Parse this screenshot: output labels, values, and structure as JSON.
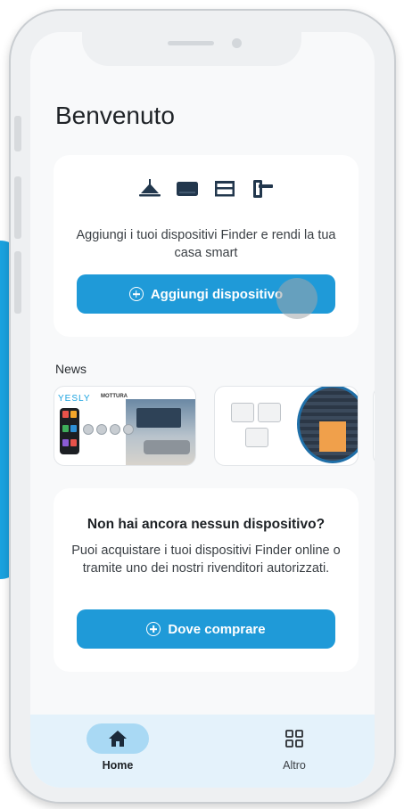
{
  "header": {
    "title": "Benvenuto"
  },
  "add_card": {
    "icons": [
      "ceiling-lamp-icon",
      "shutter-icon",
      "blinds-icon",
      "door-lock-icon"
    ],
    "description": "Aggiungi i tuoi dispositivi Finder e rendi la tua casa smart",
    "button_label": "Aggiungi dispositivo"
  },
  "news": {
    "label": "News",
    "items": [
      {
        "brand_left": "YESLY",
        "brand_right": "MOTTURA"
      },
      {
        "brand_left": "",
        "brand_right": ""
      }
    ]
  },
  "no_device_card": {
    "title": "Non hai ancora nessun dispositivo?",
    "description": "Puoi acquistare i tuoi dispositivi Finder online o tramite uno dei nostri rivenditori autorizzati.",
    "button_label": "Dove comprare"
  },
  "tabbar": {
    "items": [
      {
        "label": "Home",
        "icon": "home-icon",
        "active": true
      },
      {
        "label": "Altro",
        "icon": "grid-icon",
        "active": false
      }
    ]
  },
  "colors": {
    "accent": "#1f9ad8",
    "icon_navy": "#22374d",
    "tab_active_pill": "#a9d9f4",
    "tabbar_bg": "#e4f2fb",
    "screen_bg": "#f8f9fa"
  }
}
